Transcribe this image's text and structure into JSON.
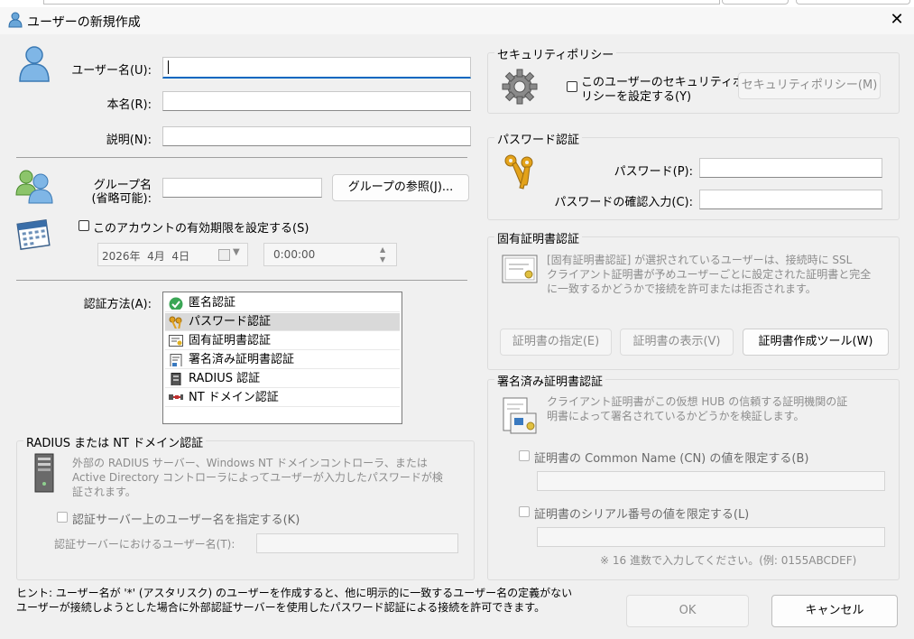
{
  "window": {
    "title": "ユーザーの新規作成",
    "close": "✕"
  },
  "user": {
    "username_label": "ユーザー名(U):",
    "username_value": "",
    "realname_label": "本名(R):",
    "realname_value": "",
    "note_label": "説明(N):",
    "note_value": ""
  },
  "group": {
    "label_line1": "グループ名",
    "label_line2": "(省略可能):",
    "value": "",
    "browse_button": "グループの参照(J)..."
  },
  "expiry": {
    "checkbox_label": "このアカウントの有効期限を設定する(S)",
    "date_value": "2026年  4月  4日",
    "time_value": "0:00:00"
  },
  "auth": {
    "label": "認証方法(A):",
    "items": [
      "匿名認証",
      "パスワード認証",
      "固有証明書認証",
      "署名済み証明書認証",
      "RADIUS 認証",
      "NT ドメイン認証"
    ],
    "selected_index": 1
  },
  "radius": {
    "group_title": "RADIUS または NT ドメイン認証",
    "desc_line1": "外部の RADIUS サーバー、Windows NT ドメインコントローラ、または",
    "desc_line2": "Active Directory コントローラによってユーザーが入力したパスワードが検",
    "desc_line3": "証されます。",
    "checkbox_label": "認証サーバー上のユーザー名を指定する(K)",
    "server_user_label": "認証サーバーにおけるユーザー名(T):",
    "server_user_value": ""
  },
  "security": {
    "group_title": "セキュリティポリシー",
    "checkbox_line1": "このユーザーのセキュリティポ",
    "checkbox_line2": "リシーを設定する(Y)",
    "button": "セキュリティポリシー(M)"
  },
  "password": {
    "group_title": "パスワード認証",
    "password_label": "パスワード(P):",
    "password_value": "",
    "confirm_label": "パスワードの確認入力(C):",
    "confirm_value": ""
  },
  "cert": {
    "group_title": "固有証明書認証",
    "desc_line1": "[固有証明書認証] が選択されているユーザーは、接続時に SSL",
    "desc_line2": "クライアント証明書が予めユーザーごとに設定された証明書と完全",
    "desc_line3": "に一致するかどうかで接続を許可または拒否されます。",
    "specify_button": "証明書の指定(E)",
    "view_button": "証明書の表示(V)",
    "tool_button": "証明書作成ツール(W)"
  },
  "signed": {
    "group_title": "署名済み証明書認証",
    "desc_line1": "クライアント証明書がこの仮想 HUB の信頼する証明機関の証",
    "desc_line2": "明書によって署名されているかどうかを検証します。",
    "cn_checkbox": "証明書の Common Name (CN) の値を限定する(B)",
    "cn_value": "",
    "serial_checkbox": "証明書のシリアル番号の値を限定する(L)",
    "serial_value": "",
    "hint": "※ 16 進数で入力してください。(例: 0155ABCDEF)"
  },
  "hint": {
    "line1": "ヒント: ユーザー名が '*' (アスタリスク) のユーザーを作成すると、他に明示的に一致するユーザー名の定義がない",
    "line2": "ユーザーが接続しようとした場合に外部認証サーバーを使用したパスワード認証による接続を許可できます。"
  },
  "buttons": {
    "ok": "OK",
    "cancel": "キャンセル"
  }
}
